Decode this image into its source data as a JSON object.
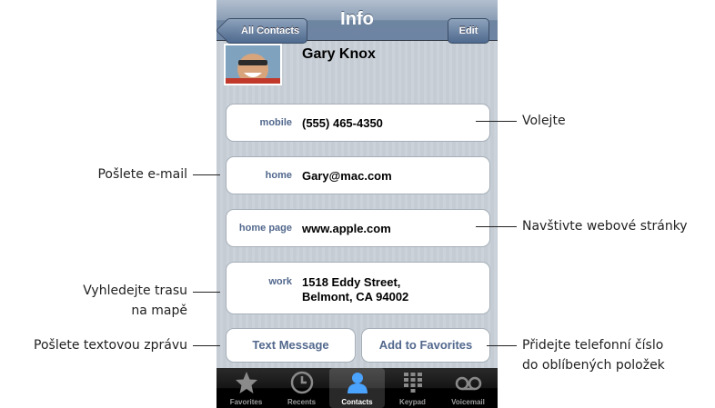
{
  "navbar": {
    "back_label": "All Contacts",
    "title": "Info",
    "edit_label": "Edit"
  },
  "contact": {
    "name": "Gary Knox"
  },
  "fields": {
    "mobile": {
      "label": "mobile",
      "value": "(555) 465-4350"
    },
    "email": {
      "label": "home",
      "value": "Gary@mac.com"
    },
    "homepage": {
      "label": "home page",
      "value": "www.apple.com"
    },
    "work": {
      "label": "work",
      "line1": "1518 Eddy Street,",
      "line2": "Belmont, CA 94002"
    }
  },
  "buttons": {
    "text_message": "Text Message",
    "add_favorites": "Add to Favorites"
  },
  "tabbar": {
    "favorites": "Favorites",
    "recents": "Recents",
    "contacts": "Contacts",
    "keypad": "Keypad",
    "voicemail": "Voicemail",
    "active": "Contacts"
  },
  "callouts": {
    "call": "Volejte",
    "email": "Pošlete e-mail",
    "website": "Navštivte webové stránky",
    "map_line1": "Vyhledejte trasu",
    "map_line2": "na mapě",
    "sms": "Pošlete textovou zprávu",
    "favorites_line1": "Přidejte telefonní číslo",
    "favorites_line2": "do oblíbených položek"
  },
  "colors": {
    "label_blue": "#52688d",
    "nav_blue": "#6d84a2",
    "stripe": "#c5ccd4"
  }
}
